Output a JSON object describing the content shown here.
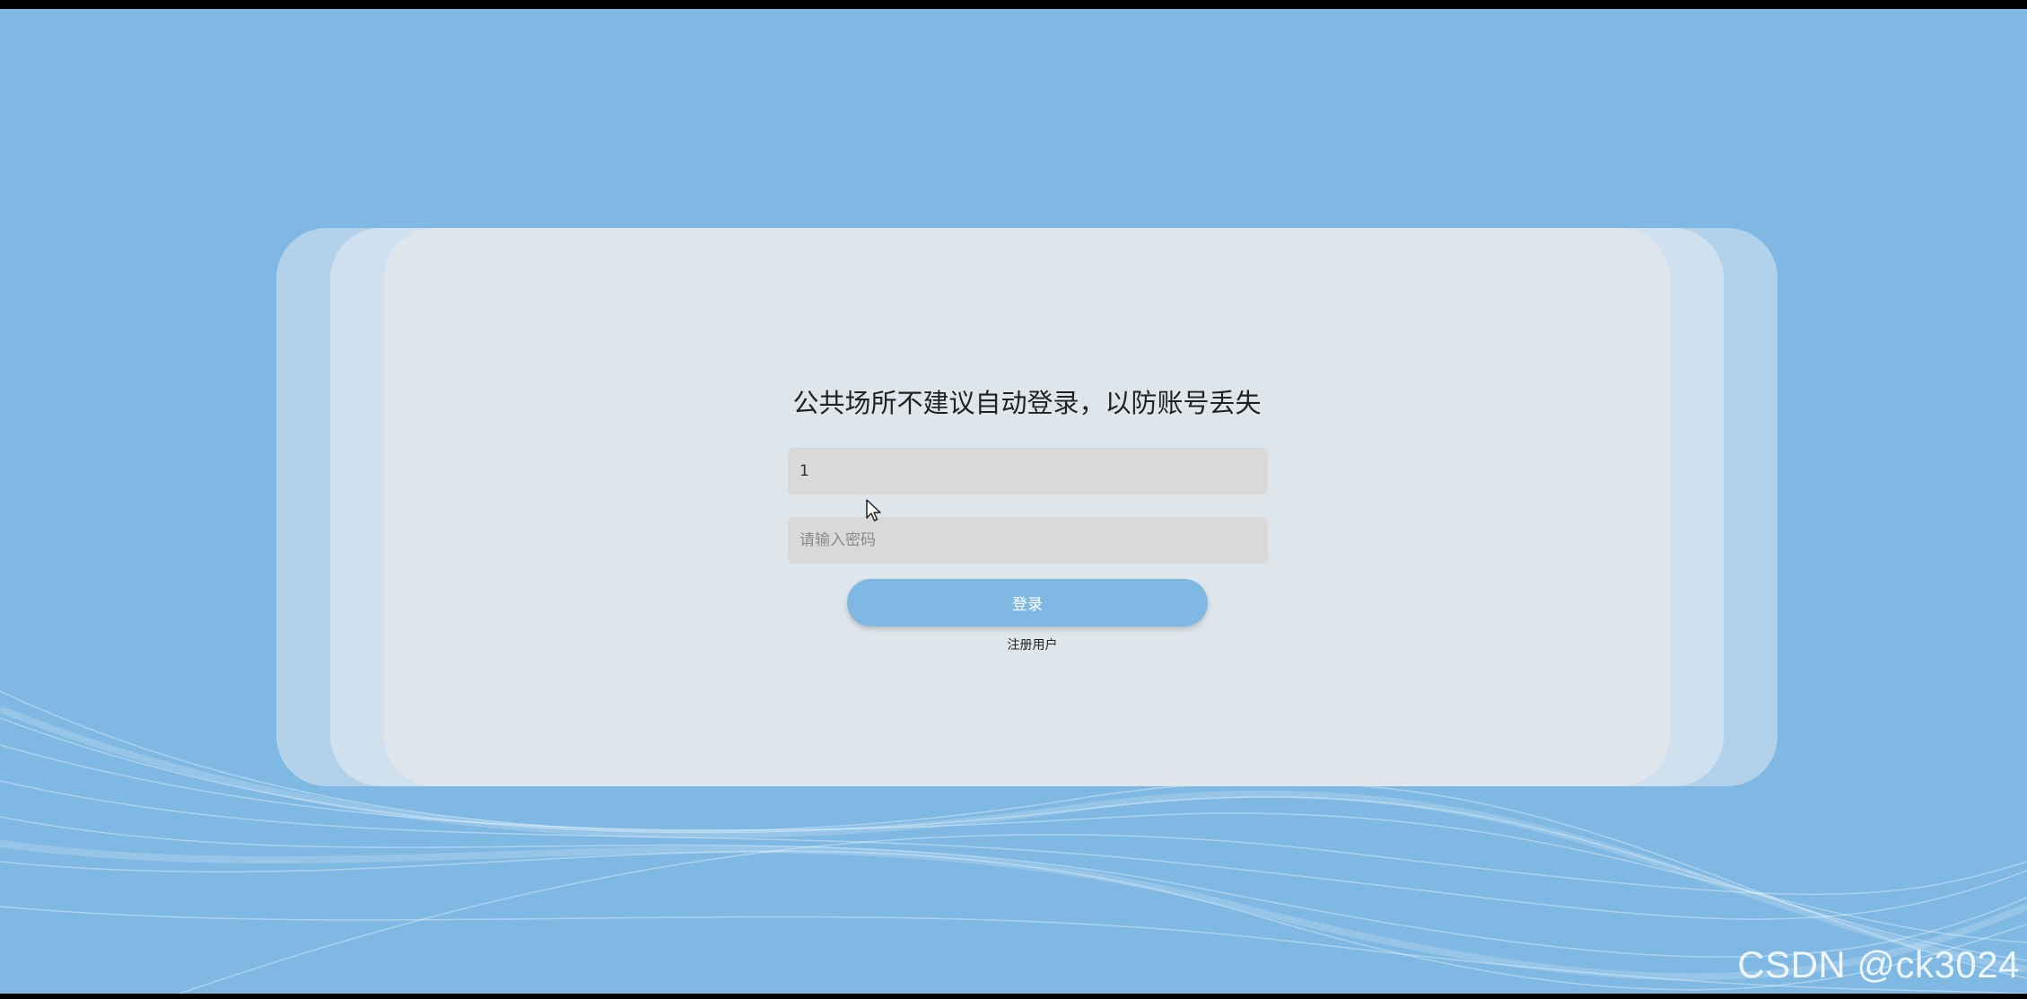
{
  "login": {
    "title": "公共场所不建议自动登录，以防账号丢失",
    "username_value": "1",
    "password_placeholder": "请输入密码",
    "login_label": "登录",
    "register_label": "注册用户"
  },
  "watermark": "CSDN @ck3024",
  "colors": {
    "background": "#7fb9e3",
    "card": "#dfe6eb",
    "input": "#d9d9d9",
    "button": "#7fb9e3"
  },
  "icons": {
    "cursor": "arrow-cursor-icon"
  }
}
